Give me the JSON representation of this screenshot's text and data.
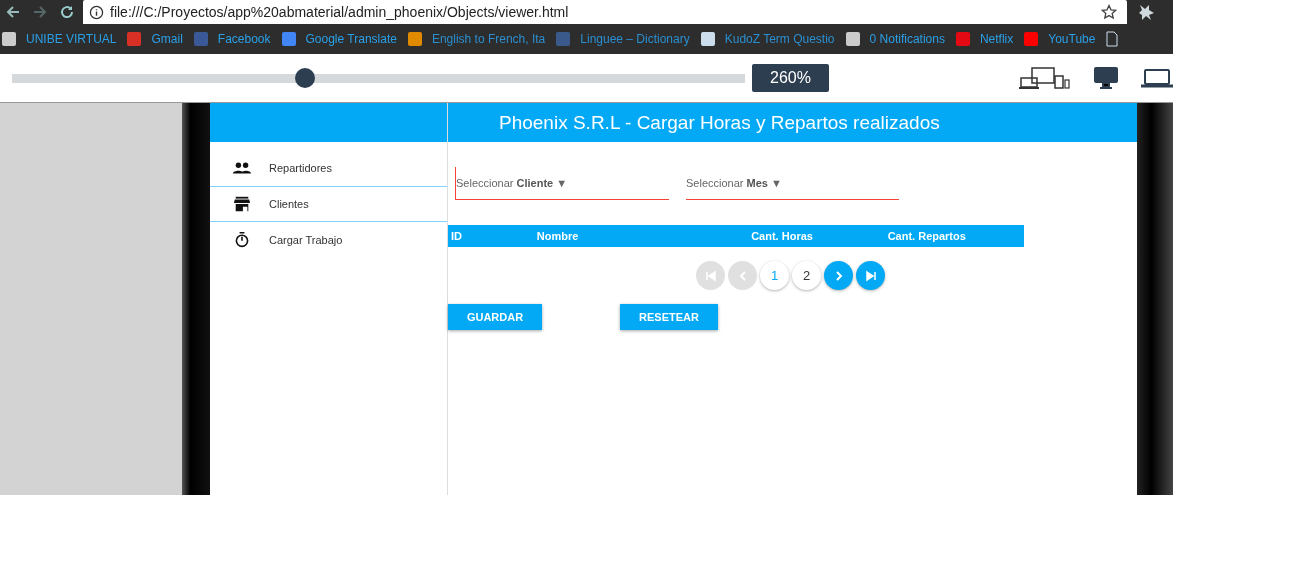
{
  "browser": {
    "url": "file:///C:/Proyectos/app%20abmaterial/admin_phoenix/Objects/viewer.html",
    "bookmarks": [
      "UNIBE VIRTUAL",
      "Gmail",
      "Facebook",
      "Google Translate",
      "English to French, Ita",
      "Linguee – Dictionary",
      "KudoZ Term Questio",
      "0 Notifications",
      "Netflix",
      "YouTube"
    ]
  },
  "viewer": {
    "zoom": {
      "level": 0.4,
      "reading": "260%"
    }
  },
  "app": {
    "title": "Phoenix S.R.L - Cargar Horas y Repartos realizados",
    "sidebar": [
      {
        "label": "Repartidores",
        "selected": false
      },
      {
        "label": "Clientes",
        "selected": true
      },
      {
        "label": "Cargar Trabajo",
        "selected": false
      }
    ],
    "selects": [
      {
        "prefix": "Seleccionar",
        "value": "Cliente",
        "caret": "▼"
      },
      {
        "prefix": "Seleccionar",
        "value": "Mes",
        "caret": "▼"
      }
    ],
    "table": {
      "columns": [
        "ID",
        "Nombre",
        "Cant. Horas",
        "Cant. Repartos"
      ]
    },
    "pagination": {
      "pages": [
        {
          "label": "1",
          "selected": true
        },
        {
          "label": "2",
          "selected": false
        }
      ],
      "first_disabled": true,
      "prev_disabled": true,
      "next_disabled": false,
      "last_disabled": false
    },
    "buttons": [
      "GUARDAR",
      "RESETEAR"
    ]
  }
}
